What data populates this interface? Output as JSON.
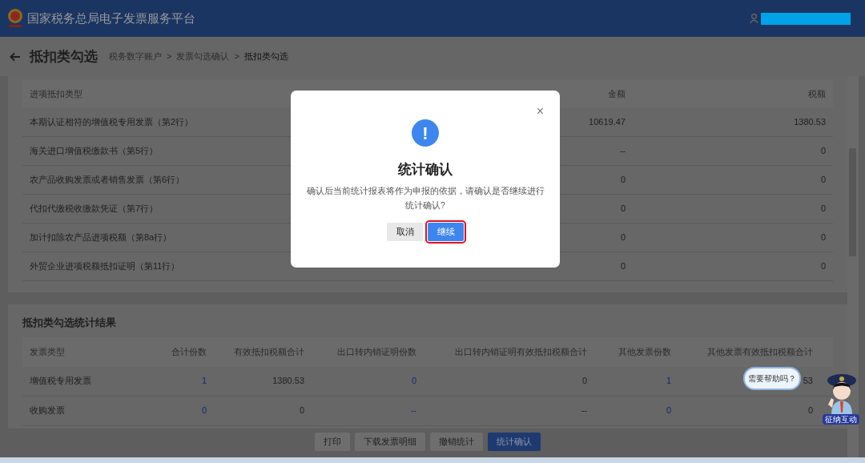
{
  "header": {
    "title": "国家税务总局电子发票服务平台"
  },
  "page": {
    "title": "抵扣类勾选",
    "separator": ">",
    "breadcrumb": [
      {
        "label": "税务数字账户",
        "current": false
      },
      {
        "label": "发票勾选确认",
        "current": false
      },
      {
        "label": "抵扣类勾选",
        "current": true
      }
    ]
  },
  "deduction_table": {
    "columns": [
      {
        "label": "进项抵扣类型",
        "kind": "name"
      },
      {
        "label": "金额",
        "kind": "amount"
      },
      {
        "label": "税额",
        "kind": "amount"
      }
    ],
    "rows": [
      [
        "本期认证相符的增值税专用发票（第2行）",
        "10619.47",
        "1380.53"
      ],
      [
        "海关进口增值税缴款书（第5行）",
        "--",
        "0"
      ],
      [
        "农产品收购发票或者销售发票（第6行）",
        "0",
        "0"
      ],
      [
        "代扣代缴税收缴款凭证（第7行）",
        "0",
        "0"
      ],
      [
        "加计扣除农产品进项税额（第8a行）",
        "0",
        "0"
      ],
      [
        "外贸企业进项税额抵扣证明（第11行）",
        "0",
        "0"
      ]
    ]
  },
  "summary": {
    "title": "抵扣类勾选统计结果",
    "columns": [
      {
        "label": "发票类型",
        "kind": "name"
      },
      {
        "label": "合计份数",
        "kind": "count"
      },
      {
        "label": "有效抵扣税额合计",
        "kind": "amount"
      },
      {
        "label": "出口转内销证明份数",
        "kind": "count"
      },
      {
        "label": "出口转内销证明有效抵扣税额合计",
        "kind": "amount"
      },
      {
        "label": "其他发票份数",
        "kind": "count"
      },
      {
        "label": "其他发票有效抵扣税额合计",
        "kind": "amount"
      }
    ],
    "rows": [
      [
        "增值税专用发票",
        "1",
        "1380.53",
        "0",
        "0",
        "1",
        "53"
      ],
      [
        "收购发票",
        "0",
        "0",
        "--",
        "--",
        "0",
        "0"
      ]
    ]
  },
  "actions": [
    {
      "label": "打印",
      "primary": false
    },
    {
      "label": "下载发票明细",
      "primary": false
    },
    {
      "label": "撤销统计",
      "primary": false
    },
    {
      "label": "统计确认",
      "primary": true
    }
  ],
  "dialog": {
    "close": "×",
    "icon": "!",
    "title": "统计确认",
    "message": "确认后当前统计报表将作为申报的依据，请确认是否继续进行统计确认?",
    "buttons": [
      {
        "label": "取消",
        "primary": false,
        "focused": false
      },
      {
        "label": "继续",
        "primary": true,
        "focused": true
      }
    ]
  },
  "assistant": {
    "bubble": "需要帮助吗？",
    "badge": "征纳互动"
  }
}
